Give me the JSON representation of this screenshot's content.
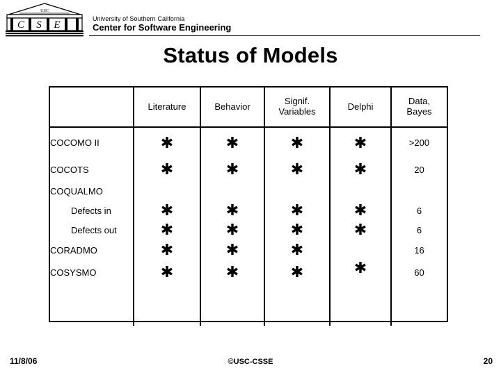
{
  "header": {
    "logo_letters": [
      "C",
      "S",
      "E"
    ],
    "logo_top_text": "USC",
    "university": "University of Southern California",
    "center": "Center for Software Engineering"
  },
  "title": "Status of Models",
  "table": {
    "columns": [
      "",
      "Literature",
      "Behavior",
      "Signif.\nVariables",
      "Delphi",
      "Data,\nBayes"
    ],
    "columns_display": [
      {
        "line1": "",
        "line2": ""
      },
      {
        "line1": "Literature",
        "line2": ""
      },
      {
        "line1": "Behavior",
        "line2": ""
      },
      {
        "line1": "Signif.",
        "line2": "Variables"
      },
      {
        "line1": "Delphi",
        "line2": ""
      },
      {
        "line1": "Data,",
        "line2": "Bayes"
      }
    ],
    "star_glyph": "✱",
    "rows": [
      {
        "label": "COCOMO II",
        "indent": false,
        "literature": "✱",
        "behavior": "✱",
        "signif": "✱",
        "delphi": "✱",
        "data": ">200"
      },
      {
        "label": "COCOTS",
        "indent": false,
        "literature": "✱",
        "behavior": "✱",
        "signif": "✱",
        "delphi": "✱",
        "data": "20"
      },
      {
        "label": "COQUALMO",
        "indent": false,
        "literature": "",
        "behavior": "",
        "signif": "",
        "delphi": "",
        "data": ""
      },
      {
        "label": "Defects in",
        "indent": true,
        "literature": "✱",
        "behavior": "✱",
        "signif": "✱",
        "delphi": "✱",
        "data": "6"
      },
      {
        "label": "Defects out",
        "indent": true,
        "literature": "✱",
        "behavior": "✱",
        "signif": "✱",
        "delphi": "✱",
        "data": "6"
      },
      {
        "label": "CORADMO",
        "indent": false,
        "literature": "✱",
        "behavior": "✱",
        "signif": "✱",
        "delphi": "",
        "data": "16"
      },
      {
        "label": "COSYSMO",
        "indent": false,
        "literature": "✱",
        "behavior": "✱",
        "signif": "✱",
        "delphi": "✱",
        "data": "60"
      }
    ]
  },
  "footer": {
    "date": "11/8/06",
    "copyright": "©USC-CSSE",
    "page": "20"
  }
}
